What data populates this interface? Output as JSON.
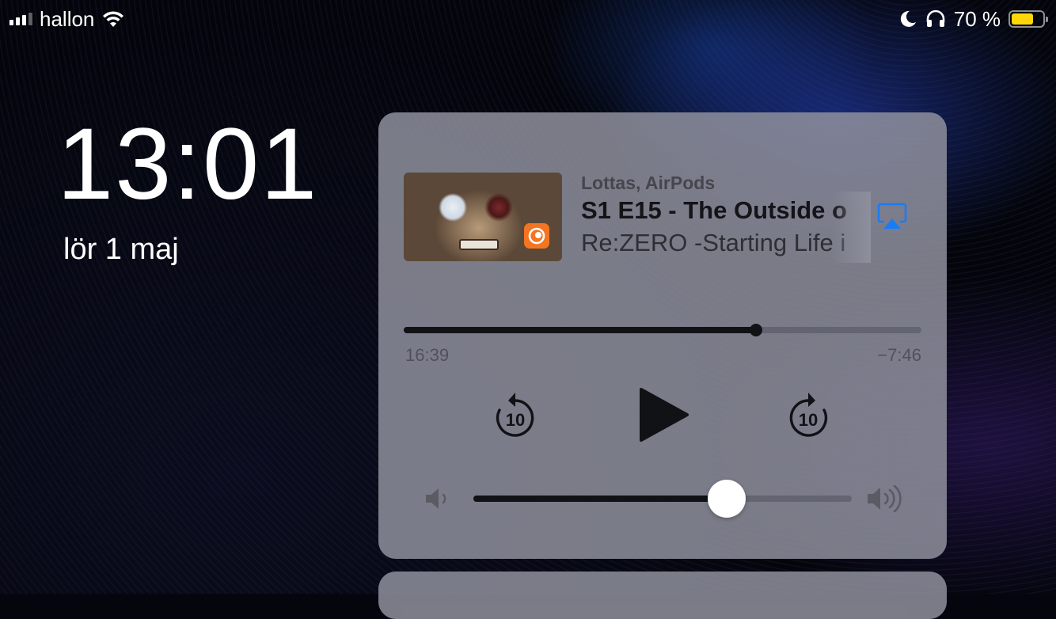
{
  "status_bar": {
    "carrier": "hallon",
    "signal_bars_filled": 3,
    "signal_bars_total": 4,
    "icons": [
      "signal-icon",
      "wifi-icon",
      "moon-icon",
      "headphones-icon",
      "battery-icon"
    ],
    "battery_percent_label": "70 %",
    "battery_level": 0.7,
    "battery_color": "#ffd60a"
  },
  "lock_screen": {
    "time": "13:01",
    "date": "lör 1 maj"
  },
  "now_playing": {
    "route": "Lottas, AirPods",
    "title": "S1 E15 - The Outside o",
    "subtitle": "Re:ZERO -Starting Life i",
    "app_icon": "crunchyroll-icon",
    "app_color": "#f47521",
    "airplay_icon": "airplay-icon",
    "airplay_color": "#1a7cf5",
    "elapsed": "16:39",
    "remaining": "−7:46",
    "progress": 0.68,
    "controls": {
      "skip_back_label": "10",
      "skip_forward_label": "10",
      "play_icon": "play-icon"
    },
    "volume": 0.67
  }
}
